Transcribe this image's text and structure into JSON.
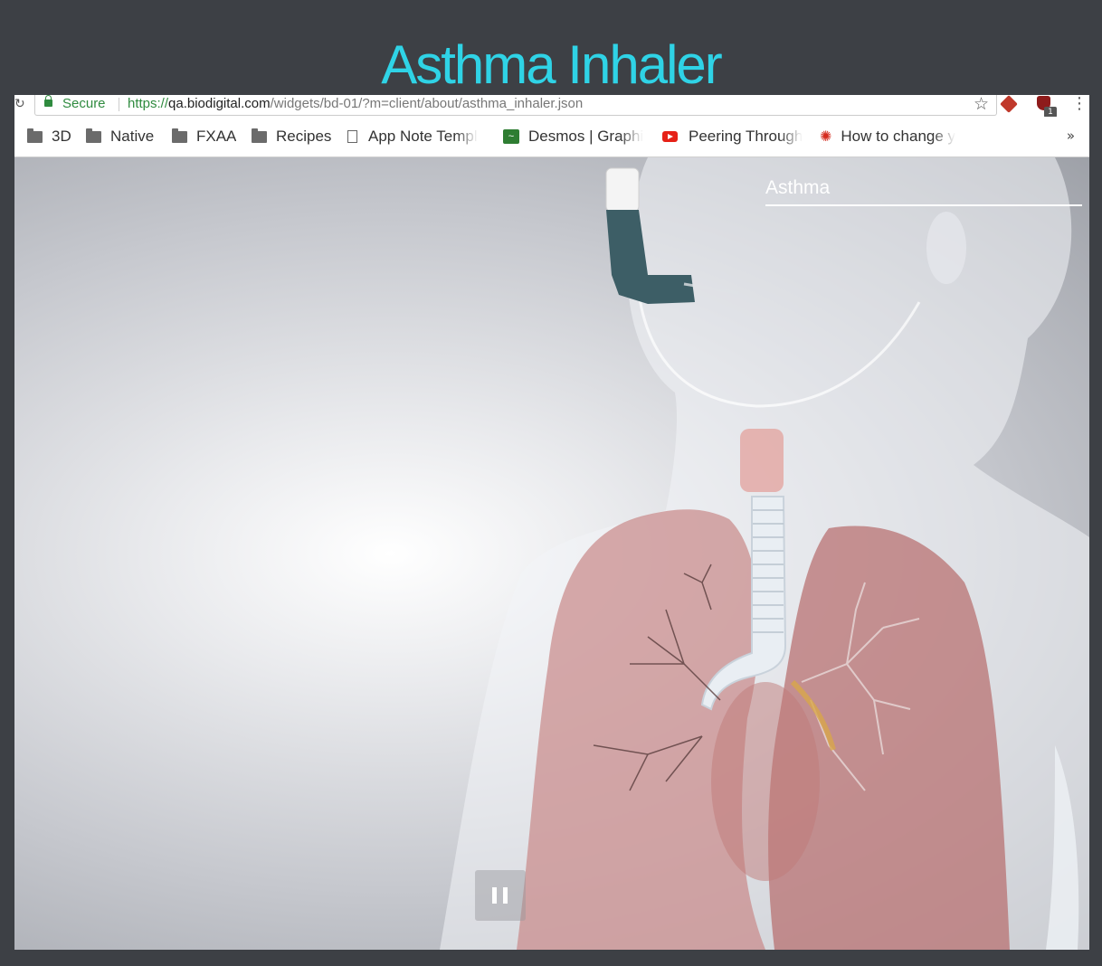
{
  "page": {
    "title": "Asthma Inhaler"
  },
  "browser": {
    "address_bar": {
      "secure_label": "Secure",
      "url_scheme": "https://",
      "url_host": "qa.biodigital.com",
      "url_path": "/widgets/bd-01/?m=client/about/asthma_inhaler.json"
    },
    "extension_badge": "1",
    "bookmarks": [
      {
        "label": "3D",
        "icon": "folder-icon"
      },
      {
        "label": "Native",
        "icon": "folder-icon"
      },
      {
        "label": "FXAA",
        "icon": "folder-icon"
      },
      {
        "label": "Recipes",
        "icon": "folder-icon"
      },
      {
        "label": "App Note Templ",
        "icon": "page-icon"
      },
      {
        "label": "Desmos | Graphi",
        "icon": "desmos-icon"
      },
      {
        "label": "Peering Through",
        "icon": "youtube-icon"
      },
      {
        "label": "How to change y",
        "icon": "maple-leaf-icon"
      }
    ],
    "bookmarks_overflow": "»"
  },
  "viewer": {
    "annotation_label": "Asthma",
    "lung_color": "#c98a8a",
    "inhaler_color": "#3d5e66"
  }
}
